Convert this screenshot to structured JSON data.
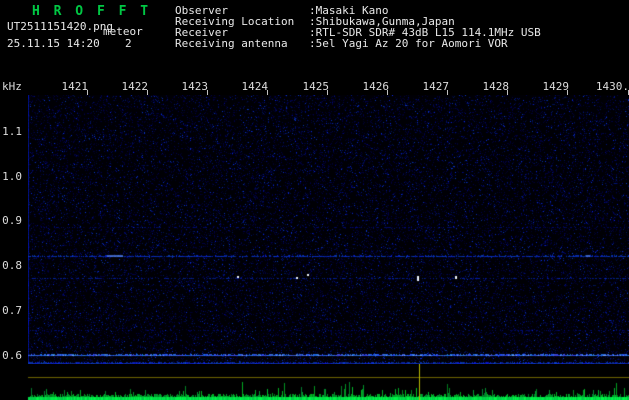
{
  "header": {
    "logo": "H R O F F T",
    "filename": "UT2511151420.png",
    "station_id": "meteor",
    "datetime": "25.11.15 14:20",
    "count": "2",
    "info": [
      {
        "label": "Observer",
        "value": ":Masaki Kano"
      },
      {
        "label": "Receiving Location",
        "value": ":Shibukawa,Gunma,Japan"
      },
      {
        "label": "Receiver",
        "value": ":RTL-SDR SDR# 43dB L15 114.1MHz USB"
      },
      {
        "label": "Receiving antenna",
        "value": ":5el Yagi Az 20 for Aomori VOR"
      }
    ]
  },
  "chart_data": {
    "type": "heatmap",
    "subtype": "radio-meteor-spectrogram",
    "title": "HROFFT 10-minute spectrogram UT2511151420",
    "x_axis": {
      "start_minute": "1420",
      "span_minutes": 10,
      "ticks": [
        "1421",
        "1422",
        "1423",
        "1424",
        "1425",
        "1426",
        "1427",
        "1428",
        "1429",
        "1430."
      ]
    },
    "y_axis": {
      "label": "kHz",
      "ticks": [
        "1.1",
        "1.0",
        "0.9",
        "0.8",
        "0.7",
        "0.6"
      ],
      "range_khz": [
        0.58,
        1.18
      ]
    },
    "grid": false,
    "legend": false,
    "carrier_lines_khz": [
      {
        "khz": 0.885,
        "level": "faint"
      },
      {
        "khz": 0.822,
        "level": "medium"
      },
      {
        "khz": 0.772,
        "level": "weak"
      },
      {
        "khz": 0.655,
        "level": "faint"
      },
      {
        "khz": 0.6,
        "level": "strong"
      }
    ],
    "meteor_echoes": [
      {
        "time_min": 1.45,
        "khz": 0.822,
        "w": 16,
        "h": 2,
        "dim": true
      },
      {
        "time_min": 3.49,
        "khz": 0.775,
        "w": 2,
        "h": 2
      },
      {
        "time_min": 4.48,
        "khz": 0.772,
        "w": 2,
        "h": 2
      },
      {
        "time_min": 4.66,
        "khz": 0.778,
        "w": 2,
        "h": 2
      },
      {
        "time_min": 6.49,
        "khz": 0.772,
        "w": 2,
        "h": 5
      },
      {
        "time_min": 7.12,
        "khz": 0.775,
        "w": 2,
        "h": 3
      },
      {
        "time_min": 9.32,
        "khz": 0.82,
        "w": 4,
        "h": 2,
        "dim": true
      }
    ],
    "bottom_strip": {
      "kind": "signal-level",
      "time_marker_min": 6.5
    },
    "palette": {
      "background": "#000005",
      "noise_blue": "#0a1a8a",
      "carrier_blue": "#2a50e0",
      "echo_white": "#dceaff",
      "strip_green": "#00d050",
      "marker_yellow": "#b8b800",
      "zero_line_olive": "#6e6400",
      "text_white": "#e8e8e8",
      "logo_green": "#00c844"
    }
  }
}
